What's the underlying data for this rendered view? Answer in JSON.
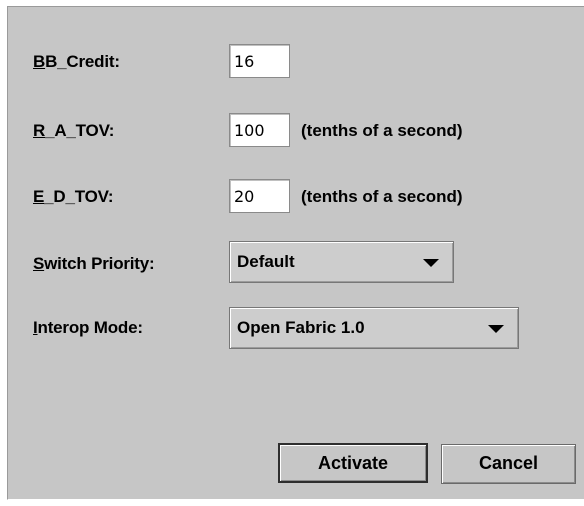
{
  "form": {
    "bb_credit": {
      "label_mnemonic": "B",
      "label_rest": "B_Credit:",
      "value": "16"
    },
    "r_a_tov": {
      "label_mnemonic": "R",
      "label_rest": "_A_TOV:",
      "value": "100",
      "unit": "(tenths of a second)"
    },
    "e_d_tov": {
      "label_mnemonic": "E",
      "label_rest": "_D_TOV:",
      "value": "20",
      "unit": "(tenths of a second)"
    },
    "switch_priority": {
      "label_mnemonic": "S",
      "label_rest": "witch Priority:",
      "selected": "Default"
    },
    "interop_mode": {
      "label_mnemonic": "I",
      "label_rest": "nterop Mode:",
      "selected": "Open Fabric 1.0"
    }
  },
  "buttons": {
    "activate": "Activate",
    "cancel": "Cancel"
  },
  "icons": {
    "dropdown": "triangle-down"
  }
}
